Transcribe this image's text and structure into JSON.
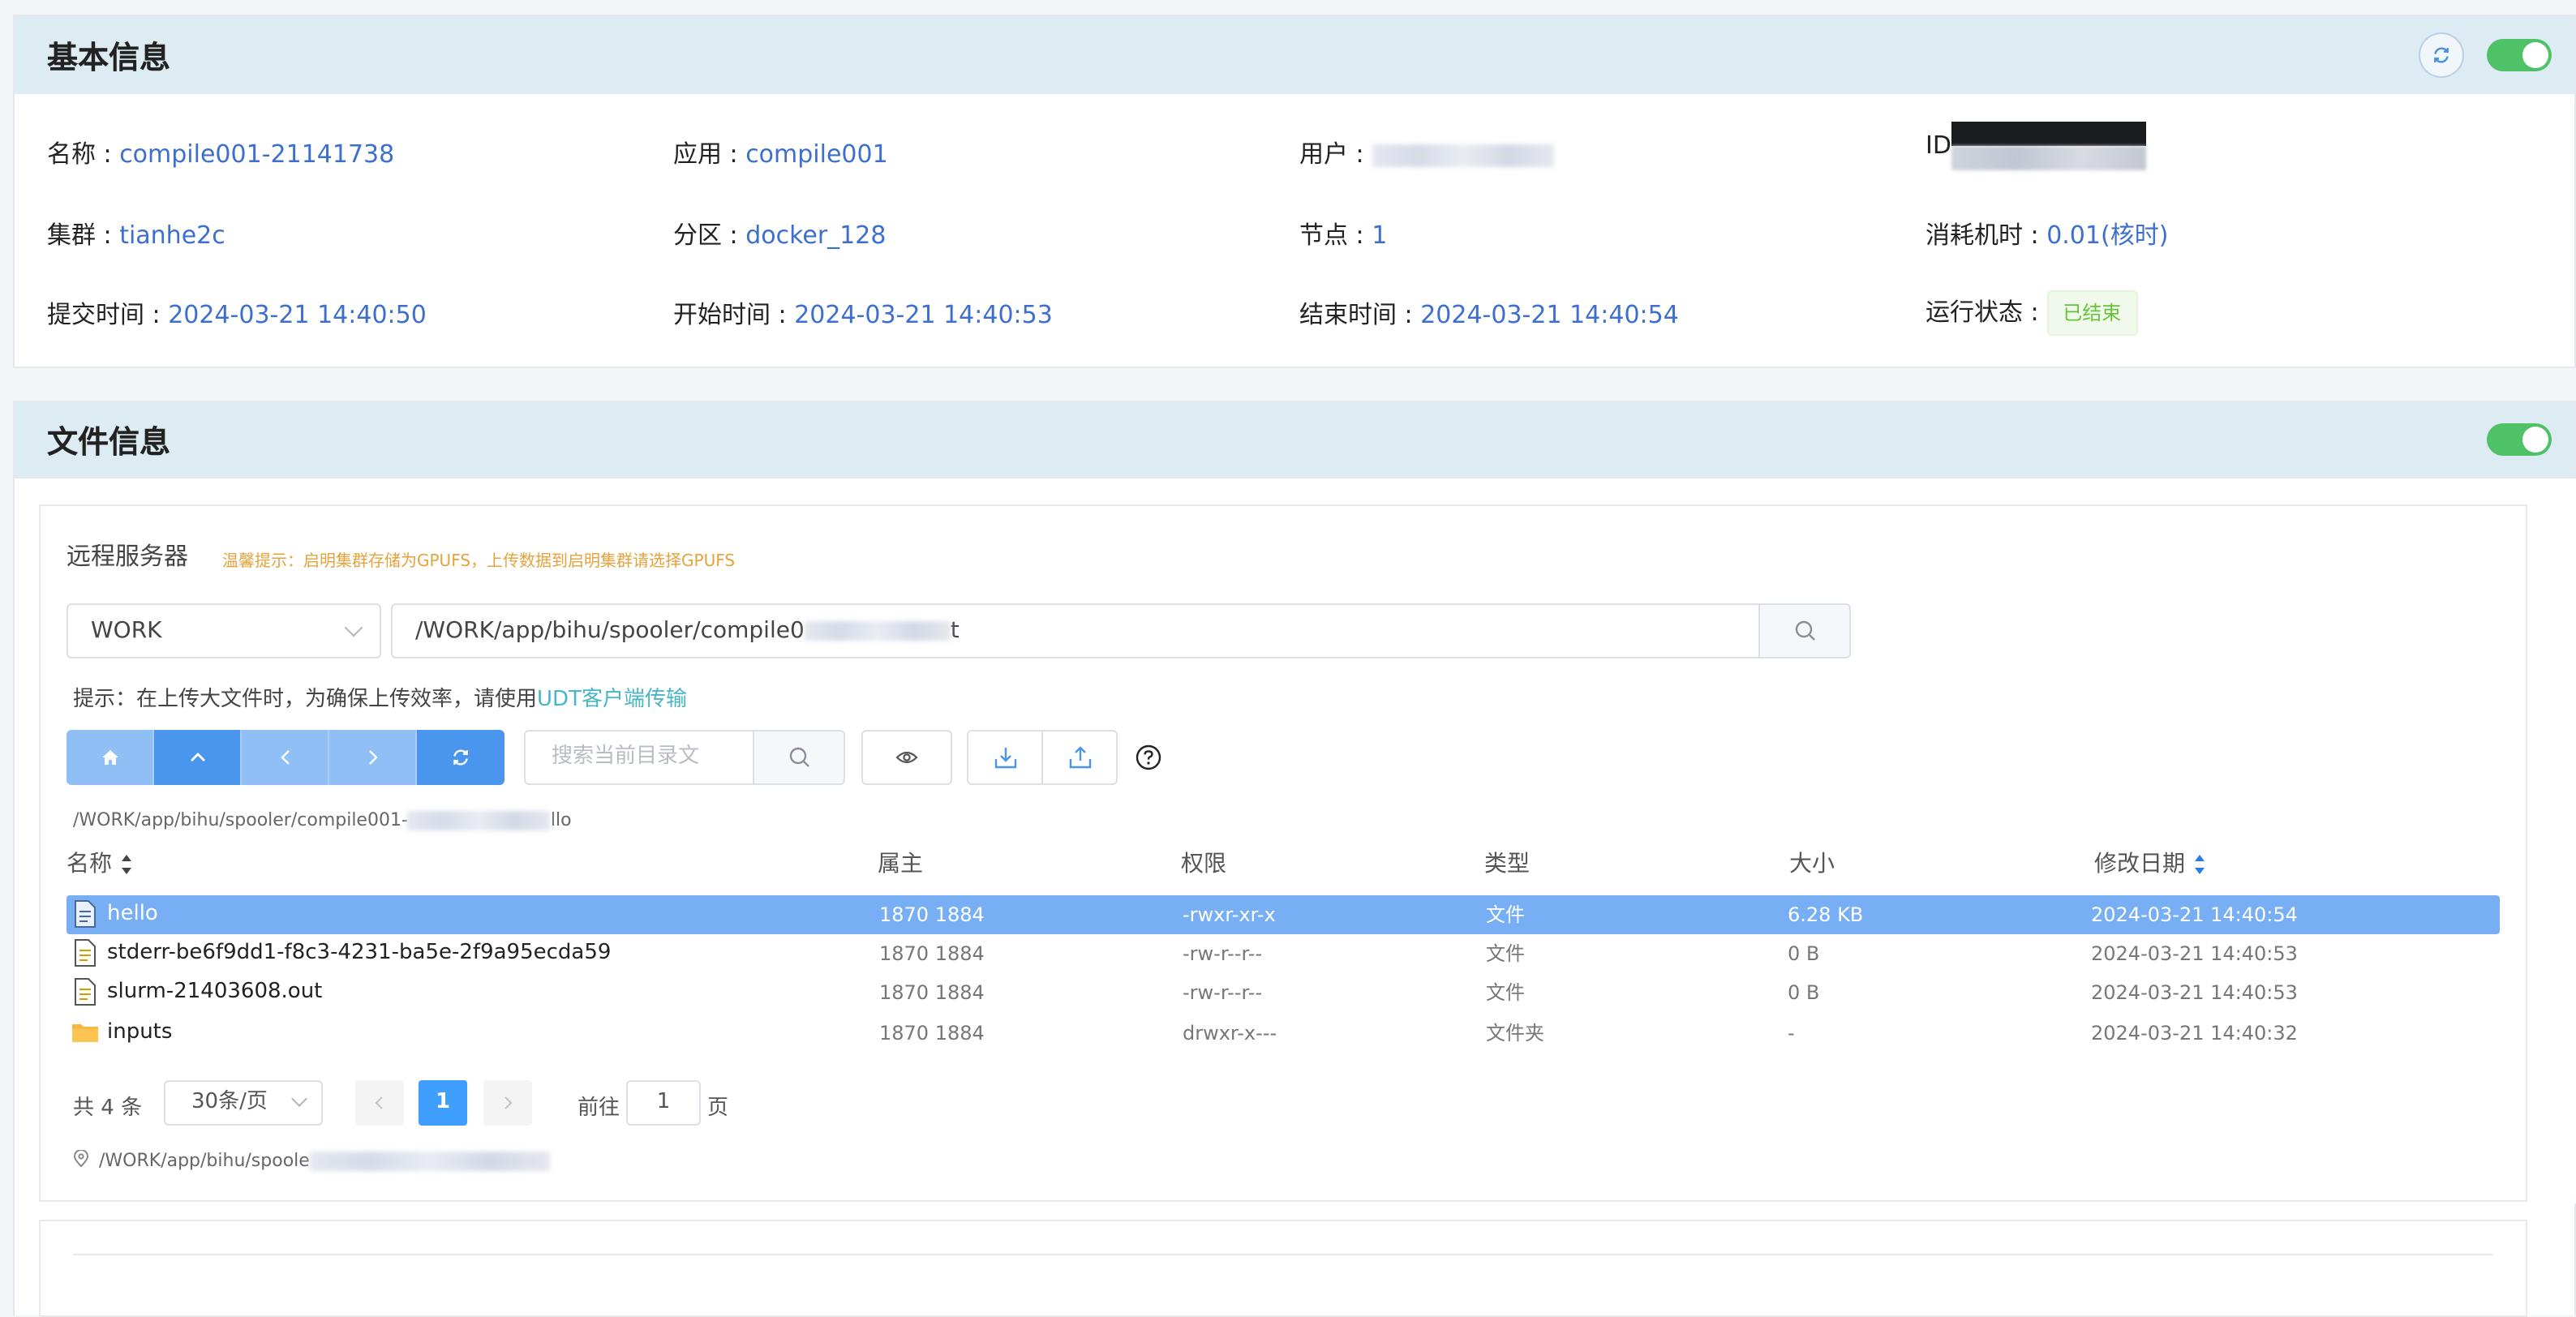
{
  "basic": {
    "title": "基本信息",
    "name_label": "名称 : ",
    "name_value": "compile001-21141738",
    "app_label": "应用 : ",
    "app_value": "compile001",
    "user_label": "用户 : ",
    "id_label": "ID",
    "cluster_label": "集群 : ",
    "cluster_value": "tianhe2c",
    "partition_label": "分区 : ",
    "partition_value": "docker_128",
    "node_label": "节点 : ",
    "node_value": "1",
    "cost_label": "消耗机时 : ",
    "cost_value": "0.01(核时)",
    "submit_label": "提交时间 : ",
    "submit_value": "2024-03-21 14:40:50",
    "start_label": "开始时间 : ",
    "start_value": "2024-03-21 14:40:53",
    "end_label": "结束时间 : ",
    "end_value": "2024-03-21 14:40:54",
    "status_label": "运行状态 : ",
    "status_value": "已结束"
  },
  "files": {
    "title": "文件信息",
    "remote_title": "远程服务器",
    "remote_tip": "温馨提示：启明集群存储为GPUFS，上传数据到启明集群请选择GPUFS",
    "storage_select": "WORK",
    "path_value": "/WORK/app/bihu/spooler/compile0",
    "path_tail": "t",
    "hint_text": "提示：在上传大文件时，为确保上传效率，请使用",
    "hint_link": "UDT客户端传输",
    "search_placeholder": "搜索当前目录文",
    "breadcrumb_head": "/WORK/app/bihu/spooler/compile001-",
    "breadcrumb_tail": "llo",
    "columns": {
      "name": "名称",
      "owner": "属主",
      "perm": "权限",
      "type": "类型",
      "size": "大小",
      "mtime": "修改日期"
    },
    "rows": [
      {
        "name": "hello",
        "owner": "1870 1884",
        "perm": "-rwxr-xr-x",
        "type": "文件",
        "size": "6.28 KB",
        "mtime": "2024-03-21 14:40:54",
        "icon": "file-icon"
      },
      {
        "name": "stderr-be6f9dd1-f8c3-4231-ba5e-2f9a95ecda59",
        "owner": "1870 1884",
        "perm": "-rw-r--r--",
        "type": "文件",
        "size": "0 B",
        "mtime": "2024-03-21 14:40:53",
        "icon": "file-icon"
      },
      {
        "name": "slurm-21403608.out",
        "owner": "1870 1884",
        "perm": "-rw-r--r--",
        "type": "文件",
        "size": "0 B",
        "mtime": "2024-03-21 14:40:53",
        "icon": "file-icon"
      },
      {
        "name": "inputs",
        "owner": "1870 1884",
        "perm": "drwxr-x---",
        "type": "文件夹",
        "size": "-",
        "mtime": "2024-03-21 14:40:32",
        "icon": "folder-icon"
      }
    ],
    "pager": {
      "total": "共 4 条",
      "page_size": "30条/页",
      "current": "1",
      "goto_prefix": "前往",
      "goto_value": "1",
      "goto_suffix": "页"
    },
    "location": "/WORK/app/bihu/spoole"
  },
  "colors": {
    "header_bg": "#ddebf3",
    "link": "#3d6fcf",
    "toggle_on": "#4fc166",
    "selected_row": "#78aff4",
    "primary": "#409eff",
    "tip": "#e6a23c",
    "success": "#67c23a"
  }
}
